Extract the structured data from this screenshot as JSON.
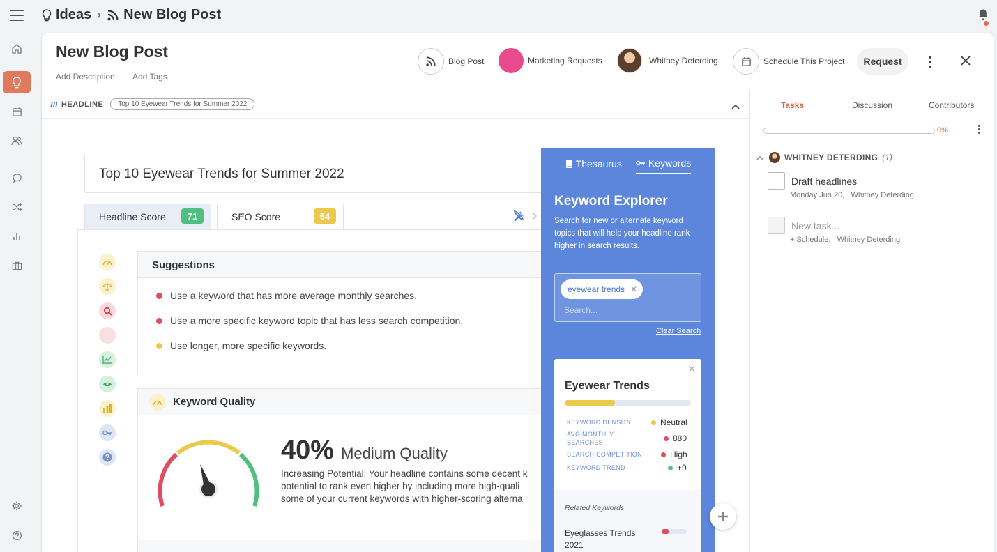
{
  "breadcrumb": {
    "root": "Ideas",
    "current": "New Blog Post"
  },
  "nav": {
    "active": "ideas-icon"
  },
  "header": {
    "title": "New Blog Post",
    "add_description": "Add Description",
    "add_tags": "Add Tags",
    "type": "Blog Post",
    "campaign": "Marketing Requests",
    "campaign_color": "#e84a8c",
    "owner": "Whitney Deterding",
    "schedule": "Schedule This Project",
    "request": "Request"
  },
  "headline_section": {
    "label": "HEADLINE",
    "pill": "Top 10 Eyewear Trends for Summer 2022"
  },
  "editor": {
    "headline_value": "Top 10 Eyewear Trends for Summer 2022",
    "tabs": [
      {
        "label": "Headline Score",
        "score": "71",
        "color": "#52bf82"
      },
      {
        "label": "SEO Score",
        "score": "54",
        "color": "#ebc94b"
      }
    ]
  },
  "suggestions": {
    "title": "Suggestions",
    "items": [
      {
        "text": "Use a keyword that has more average monthly searches.",
        "color": "#e04d5f"
      },
      {
        "text": "Use a more specific keyword topic that has less search competition.",
        "color": "#e04d5f"
      },
      {
        "text": "Use longer, more specific keywords.",
        "color": "#ebc94b"
      }
    ]
  },
  "keyword_quality": {
    "title": "Keyword Quality",
    "percent": "40%",
    "label": "Medium Quality",
    "score": 0.4,
    "desc_lines": [
      "Increasing Potential: Your headline contains some decent k",
      "potential to rank even higher by including more high-quali",
      "some of your current keywords with higher-scoring alterna"
    ]
  },
  "explorer": {
    "tab_thesaurus": "Thesaurus",
    "tab_keywords": "Keywords",
    "title": "Keyword Explorer",
    "desc": "Search for new or alternate keyword topics that will help your headline rank higher in search results.",
    "chip": "eyewear trends",
    "search_placeholder": "Search...",
    "clear": "Clear Search",
    "card": {
      "title": "Eyewear Trends",
      "fill": 0.4,
      "rows": [
        {
          "label": "KEYWORD DENSITY",
          "value": "Neutral",
          "color": "#ebc94b"
        },
        {
          "label": "AVG MONTHLY SEARCHES",
          "value": "880",
          "color": "#e04d5f"
        },
        {
          "label": "SEARCH COMPETITION",
          "value": "High",
          "color": "#e04d5f"
        },
        {
          "label": "KEYWORD TREND",
          "value": "+9",
          "color": "#52bf82"
        }
      ],
      "related_label": "Related Keywords",
      "related_item": "Eyeglasses Trends 2021",
      "related_fill": 0.3
    }
  },
  "right_panel": {
    "tabs": [
      "Tasks",
      "Discussion",
      "Contributors"
    ],
    "progress": "0%",
    "assignee": "WHITNEY DETERDING",
    "count": "(1)",
    "tasks": [
      {
        "title": "Draft headlines",
        "sub": "Monday Jun 20,   Whitney Deterding"
      },
      {
        "title": "New task...",
        "sub": "+ Schedule,   Whitney Deterding"
      }
    ]
  }
}
